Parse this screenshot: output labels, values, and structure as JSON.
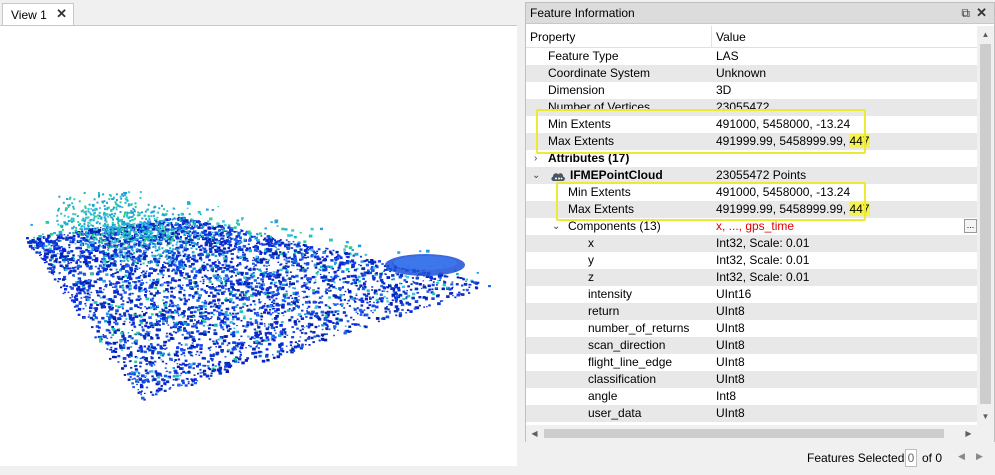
{
  "view": {
    "tab_label": "View 1",
    "tab_close": "✕"
  },
  "panel": {
    "title": "Feature Information",
    "float_glyph": "⧉",
    "close_glyph": "✕",
    "columns": {
      "property": "Property",
      "value": "Value"
    }
  },
  "rows": [
    {
      "property": "Feature Type",
      "value": "LAS"
    },
    {
      "property": "Coordinate System",
      "value": "Unknown"
    },
    {
      "property": "Dimension",
      "value": "3D"
    },
    {
      "property": "Number of Vertices",
      "value": "23055472"
    },
    {
      "property": "Min Extents",
      "value": "491000, 5458000, -13.24"
    },
    {
      "property": "Max Extents",
      "value": "491999.99, 5458999.99, ",
      "value_highlight": "447"
    },
    {
      "property": "Attributes (17)",
      "value": ""
    },
    {
      "property": "IFMEPointCloud",
      "value": "23055472 Points"
    },
    {
      "property": "Min Extents",
      "value": "491000, 5458000, -13.24"
    },
    {
      "property": "Max Extents",
      "value": "491999.99, 5458999.99, ",
      "value_highlight": "447"
    },
    {
      "property": "Components (13)",
      "value": "x, ..., gps_time",
      "button": "..."
    },
    {
      "property": "x",
      "value": "Int32, Scale: 0.01"
    },
    {
      "property": "y",
      "value": "Int32, Scale: 0.01"
    },
    {
      "property": "z",
      "value": "Int32, Scale: 0.01"
    },
    {
      "property": "intensity",
      "value": "UInt16"
    },
    {
      "property": "return",
      "value": "UInt8"
    },
    {
      "property": "number_of_returns",
      "value": "UInt8"
    },
    {
      "property": "scan_direction",
      "value": "UInt8"
    },
    {
      "property": "flight_line_edge",
      "value": "UInt8"
    },
    {
      "property": "classification",
      "value": "UInt8"
    },
    {
      "property": "angle",
      "value": "Int8"
    },
    {
      "property": "user_data",
      "value": "UInt8"
    }
  ],
  "icons": {
    "expanded_chevron": "⌄",
    "collapsed_chevron": "›",
    "pointcloud_icon": "cloud-icon"
  },
  "scroll": {
    "up": "▲",
    "down": "▼",
    "left": "◀",
    "right": "▶"
  },
  "status": {
    "label": "Features Selected:",
    "count": "0",
    "of": "of 0",
    "prev": "◀",
    "next": "▶"
  },
  "colors": {
    "highlight": "#ecea35",
    "red_text": "#e00000",
    "row_alt": "#e8e8e8"
  }
}
